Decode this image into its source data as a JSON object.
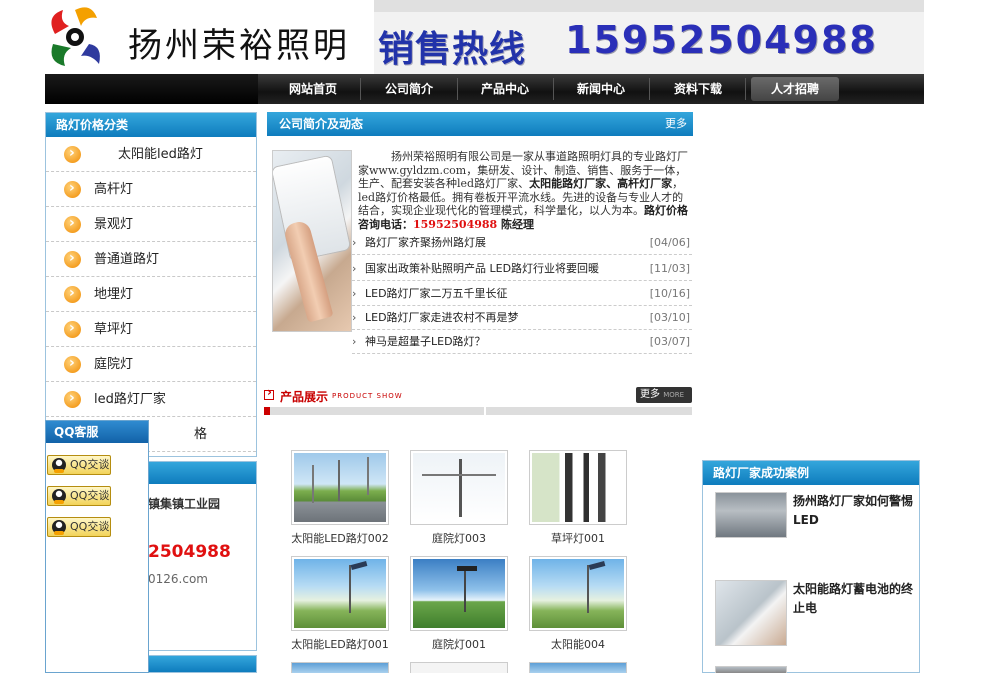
{
  "header": {
    "site_name": "扬州荣裕照明",
    "hotline_label": "销售热线",
    "hotline_number": "15952504988"
  },
  "nav": {
    "items": [
      "网站首页",
      "公司简介",
      "产品中心",
      "新闻中心",
      "资料下载",
      "人才招聘"
    ]
  },
  "categories": {
    "title": "路灯价格分类",
    "items": [
      "太阳能led路灯",
      "高杆灯",
      "景观灯",
      "普通道路灯",
      "地埋灯",
      "草坪灯",
      "庭院灯",
      "led路灯厂家",
      "格"
    ]
  },
  "contact": {
    "address_fragment": "镇集镇工业园",
    "phone_fragment": "2504988",
    "email_fragment": "0126.com"
  },
  "qq": {
    "title": "QQ客服",
    "buttons": [
      "QQ交谈",
      "QQ交谈",
      "QQ交谈"
    ]
  },
  "intro": {
    "title": "公司简介及动态",
    "more": "更多",
    "text_part1": "扬州荣裕照明有限公司是一家从事道路照明灯具的专业路灯厂家www.gyldzm.com，集研发、设计、制造、销售、服务于一体，生产、配套安装各种led路灯厂家、",
    "bold1": "太阳能路灯厂家",
    "sep": "、",
    "bold2": "高杆灯厂家",
    "text_part2": "，led路灯价格最低。拥有卷板开平流水线。先进的设备与专业人才的结合，实现企业现代化的管理模式，科学量化，以人为本。",
    "bold3": "路灯价格",
    "text_part3": "咨询电话：",
    "phone": "15952504988",
    "contact_name": " 陈经理"
  },
  "news": [
    {
      "title": "路灯厂家齐聚扬州路灯展",
      "date": "[04/06]"
    },
    {
      "title": "国家出政策补贴照明产品 LED路灯行业将要回暖",
      "date": "[11/03]"
    },
    {
      "title": "LED路灯厂家二万五千里长征",
      "date": "[10/16]"
    },
    {
      "title": "LED路灯厂家走进农村不再是梦",
      "date": "[03/10]"
    },
    {
      "title": "神马是超量子LED路灯？",
      "date": "[03/07]"
    }
  ],
  "products": {
    "title": "产品展示",
    "subtitle": "PRODUCT SHOW",
    "more": "更多",
    "more_en": "MORE",
    "items": [
      {
        "caption": "太阳能LED路灯002",
        "icon": "road-image"
      },
      {
        "caption": "庭院灯003",
        "icon": "courtyard-lamp-image"
      },
      {
        "caption": "草坪灯001",
        "icon": "lawn-lamp-image"
      },
      {
        "caption": "太阳能LED路灯001",
        "icon": "road-image"
      },
      {
        "caption": "庭院灯001",
        "icon": "courtyard-lamp-image"
      },
      {
        "caption": "太阳能004",
        "icon": "solar-lamp-image"
      }
    ]
  },
  "cases": {
    "title": "路灯厂家成功案例",
    "items": [
      {
        "title": "扬州路灯厂家如何警惕LED"
      },
      {
        "title": "太阳能路灯蓄电池的终止电"
      }
    ]
  },
  "colors": {
    "title_blue": "#0e7cbd",
    "hotline_blue": "#2a2fb8",
    "accent_red": "#e01010"
  }
}
